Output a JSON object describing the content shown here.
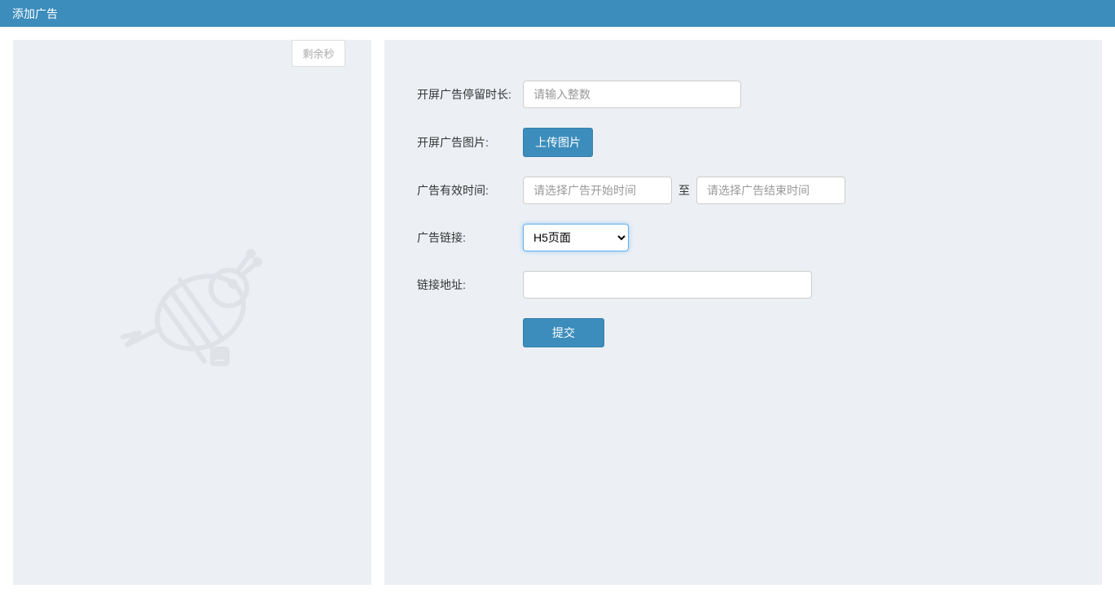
{
  "header": {
    "title": "添加广告"
  },
  "preview": {
    "countdown_text": "剩余秒"
  },
  "form": {
    "duration": {
      "label": "开屏广告停留时长:",
      "placeholder": "请输入整数",
      "value": ""
    },
    "image": {
      "label": "开屏广告图片:",
      "upload_button": "上传图片"
    },
    "valid_time": {
      "label": "广告有效时间:",
      "start_placeholder": "请选择广告开始时间",
      "end_placeholder": "请选择广告结束时间",
      "separator": "至",
      "start_value": "",
      "end_value": ""
    },
    "link_type": {
      "label": "广告链接:",
      "selected": "H5页面",
      "options": [
        "H5页面"
      ]
    },
    "link_url": {
      "label": "链接地址:",
      "value": ""
    },
    "submit_button": "提交"
  }
}
